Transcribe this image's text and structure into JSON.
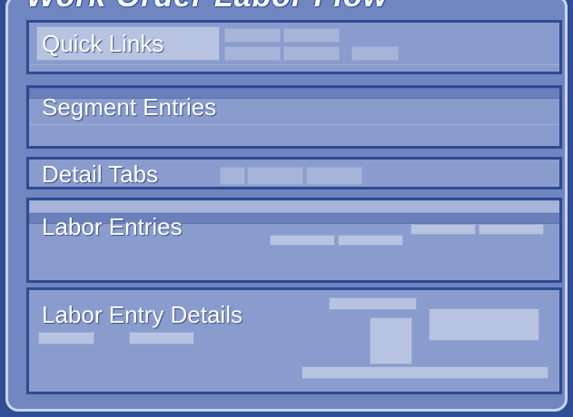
{
  "title": "Work Order Labor Flow",
  "sections": {
    "quick_links": "Quick Links",
    "segment_entries": "Segment Entries",
    "detail_tabs": "Detail Tabs",
    "labor_entries": "Labor Entries",
    "labor_entry_details": "Labor Entry Details"
  }
}
